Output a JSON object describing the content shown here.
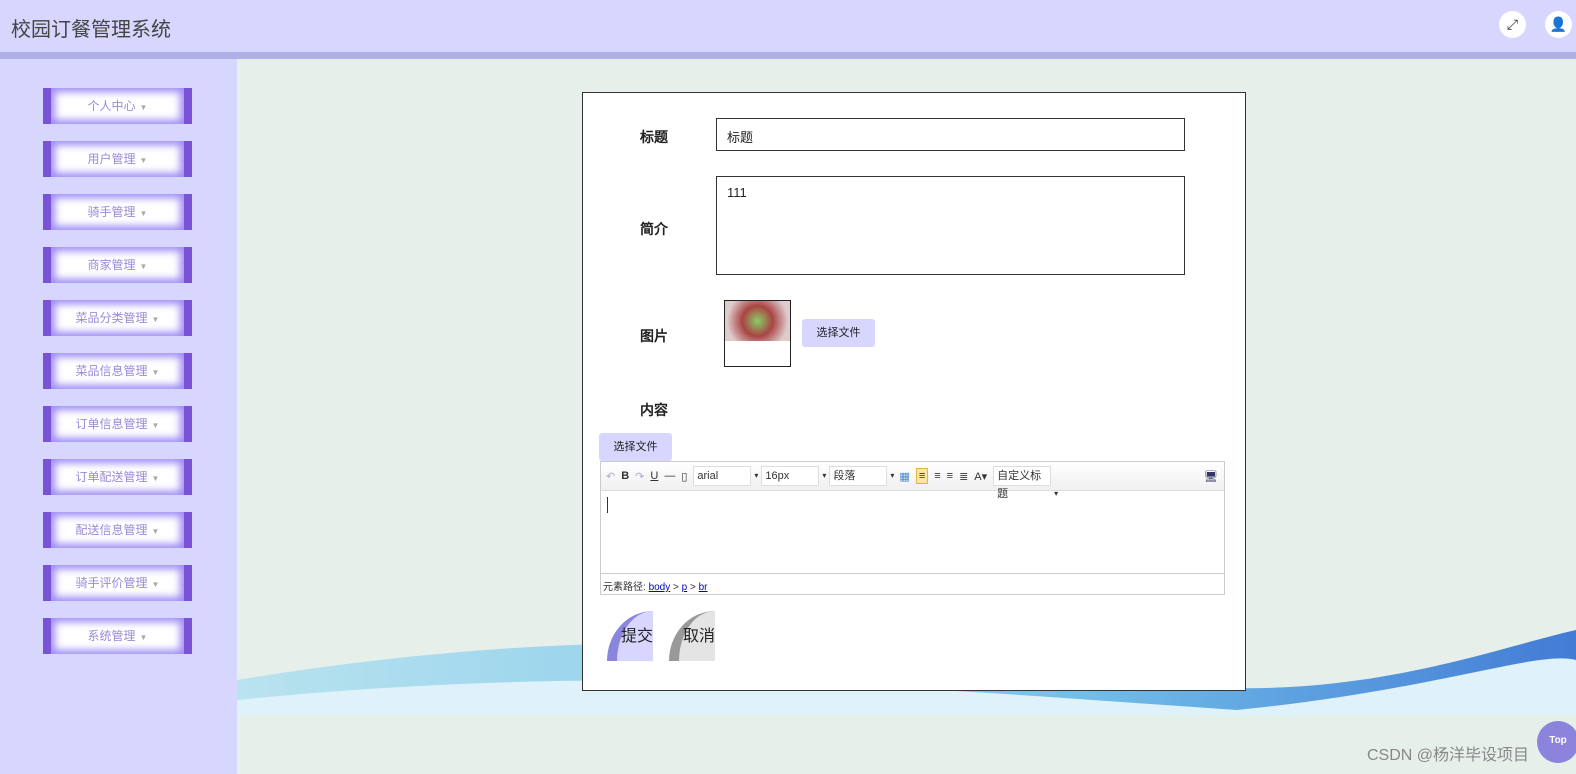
{
  "header": {
    "title": "校园订餐管理系统"
  },
  "sidebar": {
    "items": [
      {
        "label": "个人中心"
      },
      {
        "label": "用户管理"
      },
      {
        "label": "骑手管理"
      },
      {
        "label": "商家管理"
      },
      {
        "label": "菜品分类管理"
      },
      {
        "label": "菜品信息管理"
      },
      {
        "label": "订单信息管理"
      },
      {
        "label": "订单配送管理"
      },
      {
        "label": "配送信息管理"
      },
      {
        "label": "骑手评价管理"
      },
      {
        "label": "系统管理"
      }
    ]
  },
  "form": {
    "title_label": "标题",
    "title_value": "标题",
    "intro_label": "简介",
    "intro_value": "111",
    "image_label": "图片",
    "file_button": "选择文件",
    "content_label": "内容",
    "content_file_button": "选择文件",
    "editor": {
      "font": "arial",
      "size": "16px",
      "paragraph": "段落",
      "custom_heading": "自定义标题",
      "path_label": "元素路径:",
      "path": [
        "body",
        "p",
        "br"
      ]
    },
    "submit": "提交",
    "cancel": "取消"
  },
  "top_button": "Top",
  "watermark": "CSDN @杨洋毕设项目"
}
